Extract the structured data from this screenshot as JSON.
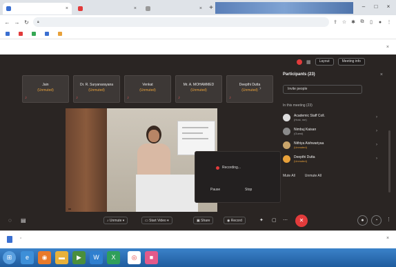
{
  "browser": {
    "tabs": [
      {
        "title": "",
        "fav_color": "#3a6fd1"
      },
      {
        "title": "",
        "fav_color": "#e23b3b"
      },
      {
        "title": "",
        "fav_color": "#999999"
      }
    ],
    "url": "",
    "bookmarks": [
      {
        "label": "",
        "color": "#3a6fd1"
      },
      {
        "label": "",
        "color": "#e23b3b"
      },
      {
        "label": "",
        "color": "#34a853"
      },
      {
        "label": "",
        "color": "#3a6fd1"
      },
      {
        "label": "",
        "color": "#e8a13a"
      }
    ],
    "infobar": {
      "message": "",
      "learn_more": ""
    }
  },
  "meeting": {
    "top_buttons": {
      "layout": "Layout",
      "meeting_info": "Meeting info"
    },
    "tiles": [
      {
        "name": "Jain",
        "role": "(Unmuted)"
      },
      {
        "name": "Dr. R. Suryanarayana",
        "role": "(Unmuted)"
      },
      {
        "name": "Venkat",
        "role": "(Unmuted)"
      },
      {
        "name": "Mr. A. MOHAMMED",
        "role": "(Unmuted)"
      },
      {
        "name": "Deepthi Dutta",
        "role": "(Unmuted)"
      }
    ],
    "video_caption": "",
    "recording_popup": {
      "status": "Recording...",
      "pause": "Pause",
      "stop": "Stop"
    },
    "participants_panel": {
      "title": "Participants (23)",
      "invite": "Invite people",
      "section": "In this meeting (23)",
      "people": [
        {
          "name": "Academic Staff Coll.",
          "role": "(Host, me)",
          "role_style": "grey"
        },
        {
          "name": "Nimbuj Kaisan",
          "role": "(Guest)",
          "role_style": "grey"
        },
        {
          "name": "Nithiya Aishwariyaa",
          "role": "(Unmuted)",
          "role_style": "orange"
        },
        {
          "name": "Deepthi Dutta",
          "role": "(Unmuted)",
          "role_style": "orange"
        }
      ],
      "mute_all": "Mute All",
      "unmute_all": "Unmute All"
    },
    "controls": {
      "unmute": "Unmute",
      "start_video": "Start Video",
      "share": "Share",
      "record": "Record"
    }
  },
  "downloads": {
    "file": "",
    "show_all": ""
  },
  "taskbar": {
    "time": "",
    "date": ""
  }
}
